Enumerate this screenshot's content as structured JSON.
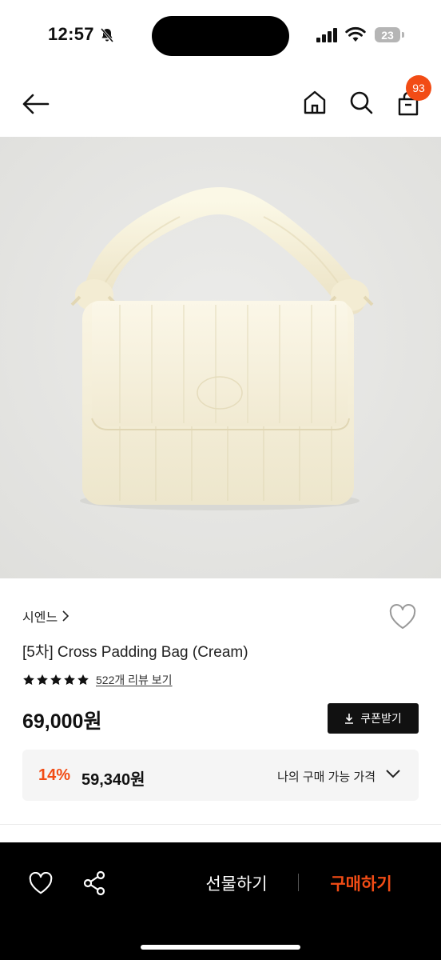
{
  "status_bar": {
    "time": "12:57",
    "battery": "23"
  },
  "header": {
    "cart_count": "93"
  },
  "product": {
    "brand": "시엔느",
    "title": "[5차] Cross Padding Bag (Cream)",
    "rating_stars": 5,
    "review_link": "522개 리뷰 보기",
    "price": "69,000원",
    "coupon_label": "쿠폰받기",
    "discount_rate": "14%",
    "discount_price": "59,340원",
    "discount_label": "나의 구매 가능 가격"
  },
  "bottom_bar": {
    "gift_label": "선물하기",
    "buy_label": "구매하기"
  },
  "colors": {
    "accent": "#f24c15",
    "dark": "#111111",
    "panel": "#f5f5f5"
  },
  "icons": [
    "bell-mute-icon",
    "signal-icon",
    "wifi-icon",
    "back-arrow-icon",
    "home-icon",
    "search-icon",
    "cart-icon",
    "heart-icon",
    "star-icon",
    "download-icon",
    "chevron-down-icon",
    "share-icon"
  ]
}
